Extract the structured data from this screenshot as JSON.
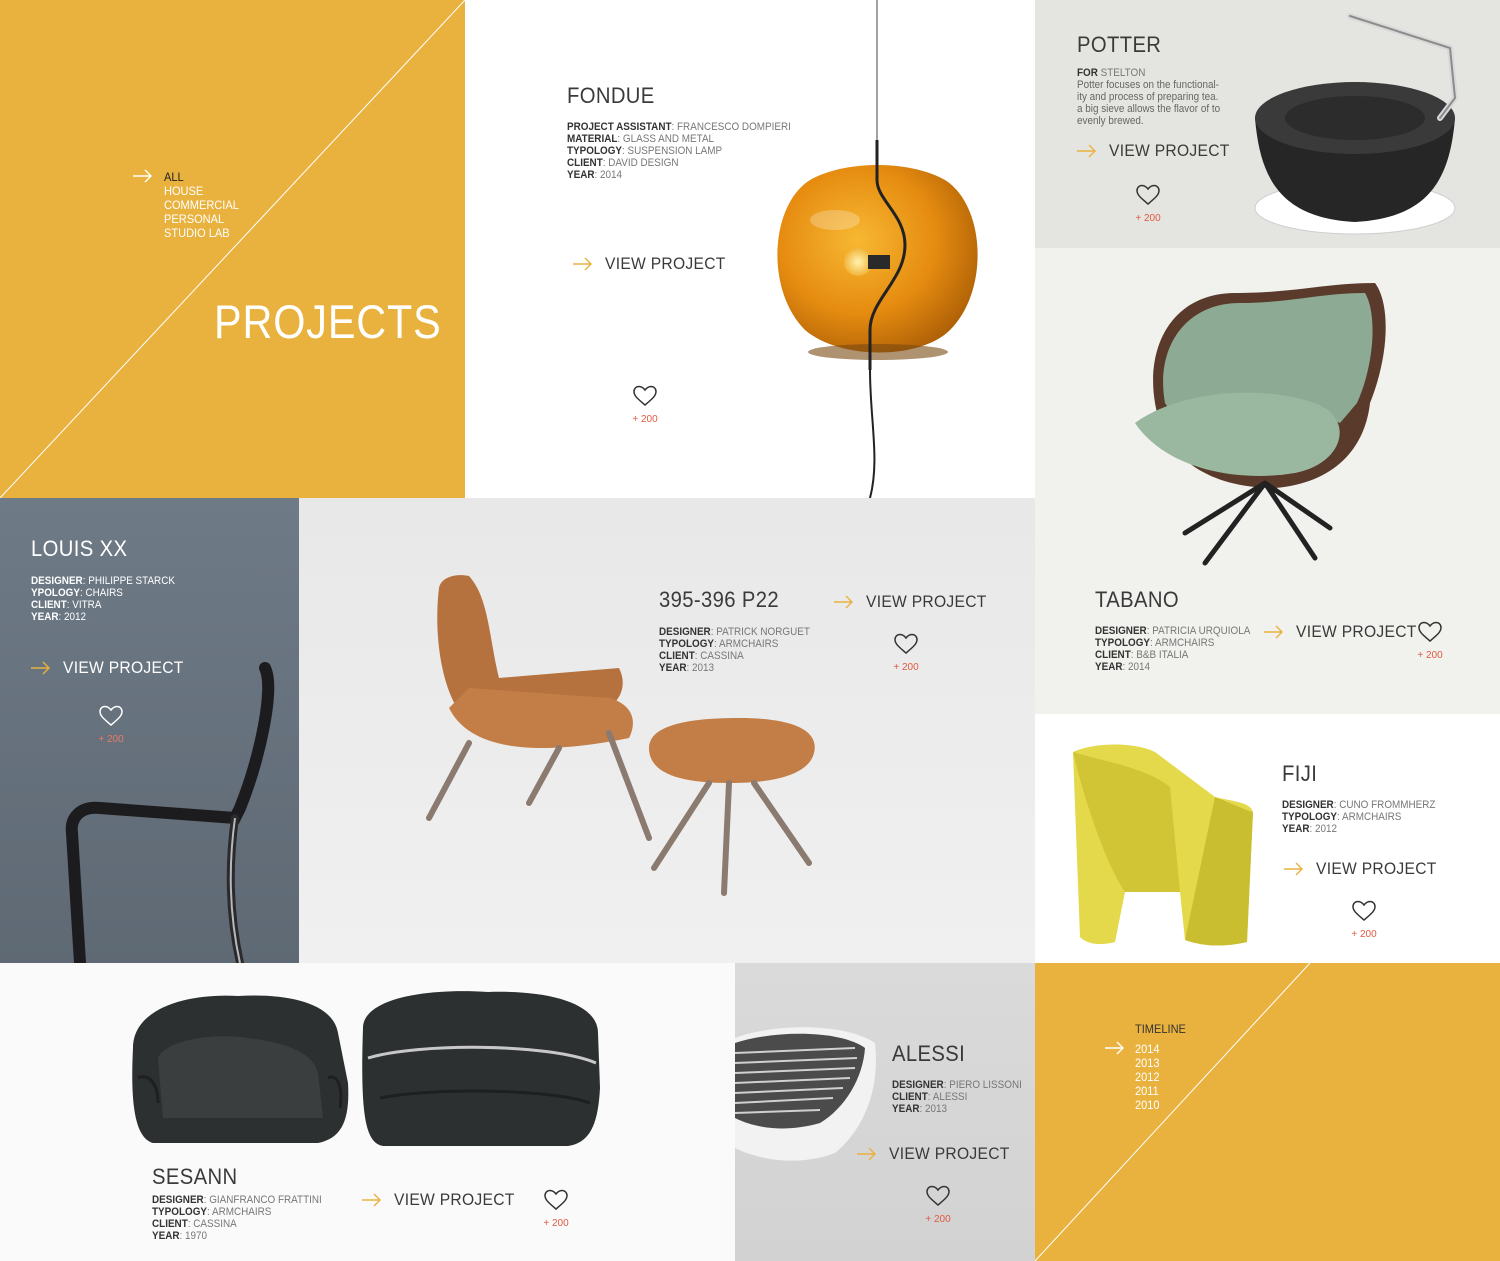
{
  "colors": {
    "accent": "#E9B23E",
    "like_red": "#E05A42",
    "text_dark": "#3A3A3A"
  },
  "filters": {
    "items": [
      "ALL",
      "HOUSE",
      "COMMERCIAL",
      "PERSONAL",
      "STUDIO LAB"
    ],
    "active": "ALL",
    "arrow_icon": "arrow-right-icon"
  },
  "page_title": "PROJECTS",
  "projects": {
    "fondue": {
      "title": "FONDUE",
      "meta": [
        {
          "label": "PROJECT ASSISTANT",
          "value": ": FRANCESCO DOMPIERI"
        },
        {
          "label": "MATERIAL",
          "value": ": GLASS AND METAL"
        },
        {
          "label": "TYPOLOGY",
          "value": ": SUSPENSION LAMP"
        },
        {
          "label": "CLIENT",
          "value": ": DAVID DESIGN"
        },
        {
          "label": "YEAR",
          "value": ": 2014"
        }
      ],
      "view": "VIEW PROJECT",
      "likes": "+ 200"
    },
    "potter": {
      "title": "POTTER",
      "for_label": "FOR",
      "for_value": " STELTON",
      "description": "Potter focuses on the functional-ity and process of preparing tea. a big sieve allows the flavor of to evenly brewed.",
      "view": "VIEW PROJECT",
      "likes": "+ 200"
    },
    "louis": {
      "title": "LOUIS XX",
      "meta": [
        {
          "label": "DESIGNER",
          "value": ": PHILIPPE STARCK"
        },
        {
          "label": "YPOLOGY",
          "value": ": CHAIRS"
        },
        {
          "label": "CLIENT",
          "value": ": VITRA"
        },
        {
          "label": "YEAR",
          "value": ": 2012"
        }
      ],
      "view": "VIEW PROJECT",
      "likes": "+ 200"
    },
    "p22": {
      "title": "395-396 P22",
      "meta": [
        {
          "label": "DESIGNER",
          "value": ": PATRICK NORGUET"
        },
        {
          "label": "TYPOLOGY",
          "value": ": ARMCHAIRS"
        },
        {
          "label": "CLIENT",
          "value": ": CASSINA"
        },
        {
          "label": "YEAR",
          "value": ": 2013"
        }
      ],
      "view": "VIEW PROJECT",
      "likes": "+ 200"
    },
    "tabano": {
      "title": "TABANO",
      "meta": [
        {
          "label": "DESIGNER",
          "value": ": PATRICIA URQUIOLA"
        },
        {
          "label": "TYPOLOGY",
          "value": ": ARMCHAIRS"
        },
        {
          "label": "CLIENT",
          "value": ": B&B ITALIA"
        },
        {
          "label": "YEAR",
          "value": ": 2014"
        }
      ],
      "view": "VIEW PROJECT",
      "likes": "+ 200"
    },
    "fiji": {
      "title": "FIJI",
      "meta": [
        {
          "label": "DESIGNER",
          "value": ": CUNO FROMMHERZ"
        },
        {
          "label": "TYPOLOGY",
          "value": ": ARMCHAIRS"
        },
        {
          "label": "YEAR",
          "value": ": 2012"
        }
      ],
      "view": "VIEW PROJECT",
      "likes": "+ 200"
    },
    "sesann": {
      "title": "SESANN",
      "meta": [
        {
          "label": "DESIGNER",
          "value": ": GIANFRANCO FRATTINI"
        },
        {
          "label": "TYPOLOGY",
          "value": ": ARMCHAIRS"
        },
        {
          "label": "CLIENT",
          "value": ": CASSINA"
        },
        {
          "label": "YEAR",
          "value": ": 1970"
        }
      ],
      "view": "VIEW PROJECT",
      "likes": "+ 200"
    },
    "alessi": {
      "title": "ALESSI",
      "meta": [
        {
          "label": "DESIGNER",
          "value": ": PIERO LISSONI"
        },
        {
          "label": "CLIENT",
          "value": ": ALESSI"
        },
        {
          "label": "YEAR",
          "value": ": 2013"
        }
      ],
      "view": "VIEW PROJECT",
      "likes": "+ 200"
    }
  },
  "timeline": {
    "label": "TIMELINE",
    "years": [
      "2014",
      "2013",
      "2012",
      "2011",
      "2010"
    ],
    "active": "2014"
  }
}
